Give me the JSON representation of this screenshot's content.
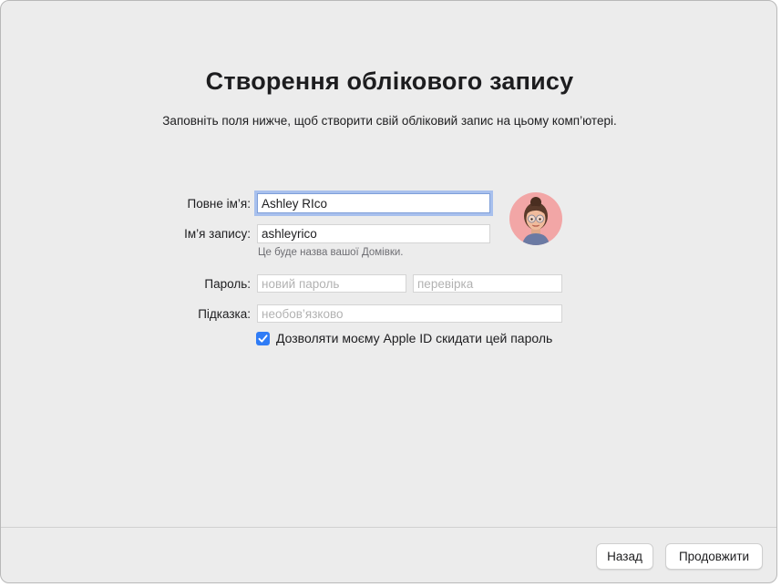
{
  "header": {
    "title": "Створення облікового запису",
    "subtitle": "Заповніть поля нижче, щоб створити свій обліковий запис на цьому комп’ютері."
  },
  "form": {
    "full_name": {
      "label": "Повне ім’я:",
      "value": "Ashley RIco"
    },
    "account_name": {
      "label": "Ім’я запису:",
      "value": "ashleyrico",
      "helper": "Це буде назва вашої Домівки."
    },
    "password": {
      "label": "Пароль:",
      "placeholder": "новий пароль",
      "verify_placeholder": "перевірка"
    },
    "hint": {
      "label": "Підказка:",
      "placeholder": "необов’язково"
    },
    "allow_apple_id_reset": {
      "label": "Дозволяти моєму Apple ID скидати цей пароль",
      "checked": true
    }
  },
  "avatar": {
    "icon": "memoji-avatar-icon"
  },
  "footer": {
    "back_label": "Назад",
    "continue_label": "Продовжити"
  },
  "colors": {
    "accent": "#2f7cf6",
    "avatar_bg": "#f2a6a6",
    "window_bg": "#ececec"
  }
}
